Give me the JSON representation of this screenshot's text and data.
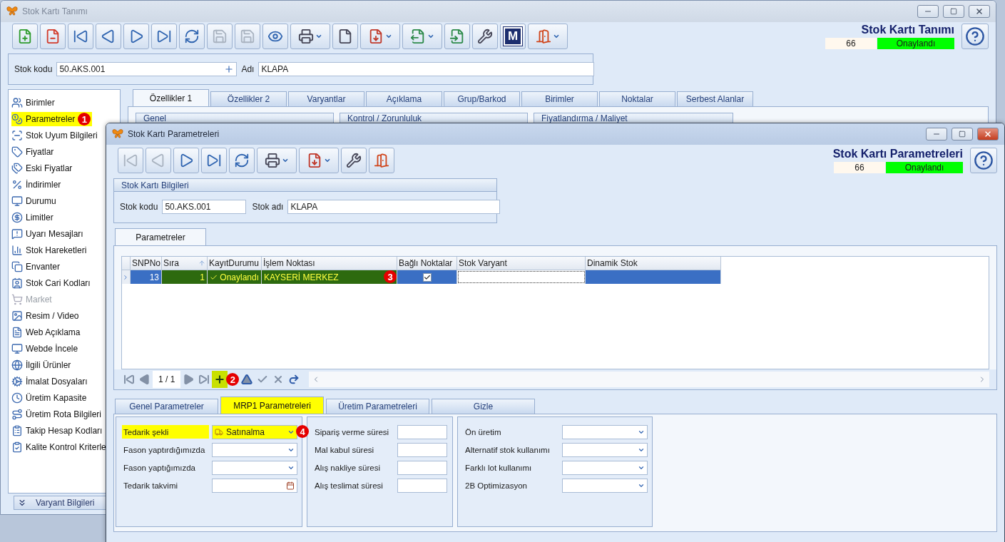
{
  "main_window": {
    "title": "Stok Kartı Tanımı",
    "header_title": "Stok Kartı Tanımı",
    "record_no": "66",
    "status": "Onaylandı",
    "toolbar": [
      {
        "kind": "new",
        "disabled": false,
        "dropdown": false
      },
      {
        "kind": "delete",
        "disabled": false,
        "dropdown": false
      },
      {
        "kind": "first",
        "disabled": false,
        "dropdown": false
      },
      {
        "kind": "previous",
        "disabled": false,
        "dropdown": false
      },
      {
        "kind": "next",
        "disabled": false,
        "dropdown": false
      },
      {
        "kind": "last",
        "disabled": false,
        "dropdown": false
      },
      {
        "kind": "refresh",
        "disabled": false,
        "dropdown": false
      },
      {
        "kind": "save",
        "disabled": true,
        "dropdown": false
      },
      {
        "kind": "save-cancel",
        "disabled": true,
        "dropdown": false
      },
      {
        "kind": "preview",
        "disabled": false,
        "dropdown": false
      },
      {
        "kind": "print",
        "disabled": false,
        "dropdown": true
      },
      {
        "kind": "attach",
        "disabled": false,
        "dropdown": false
      },
      {
        "kind": "pdf",
        "disabled": false,
        "dropdown": true
      },
      {
        "kind": "export",
        "disabled": false,
        "dropdown": true
      },
      {
        "kind": "import",
        "disabled": false,
        "dropdown": false
      },
      {
        "kind": "settings",
        "disabled": false,
        "dropdown": false
      },
      {
        "kind": "logo",
        "label": "M",
        "disabled": false,
        "dropdown": false
      },
      {
        "kind": "exit",
        "disabled": false,
        "dropdown": true
      }
    ],
    "fields": {
      "stok_kodu_label": "Stok kodu",
      "stok_kodu": "50.AKS.001",
      "adi_label": "Adı",
      "adi": "KLAPA"
    },
    "sidebar": {
      "items": [
        {
          "label": "Birimler",
          "selected": false,
          "disabled": false
        },
        {
          "label": "Parametreler",
          "selected": true,
          "disabled": false,
          "badge": "1"
        },
        {
          "label": "Stok Uyum Bilgileri",
          "selected": false,
          "disabled": false
        },
        {
          "label": "Fiyatlar",
          "selected": false,
          "disabled": false
        },
        {
          "label": "Eski Fiyatlar",
          "selected": false,
          "disabled": false
        },
        {
          "label": "İndirimler",
          "selected": false,
          "disabled": false
        },
        {
          "label": "Durumu",
          "selected": false,
          "disabled": false
        },
        {
          "label": "Limitler",
          "selected": false,
          "disabled": false
        },
        {
          "label": "Uyarı Mesajları",
          "selected": false,
          "disabled": false
        },
        {
          "label": "Stok Hareketleri",
          "selected": false,
          "disabled": false
        },
        {
          "label": "Envanter",
          "selected": false,
          "disabled": false
        },
        {
          "label": "Stok Cari Kodları",
          "selected": false,
          "disabled": false
        },
        {
          "label": "Market",
          "selected": false,
          "disabled": true
        },
        {
          "label": "Resim / Video",
          "selected": false,
          "disabled": false
        },
        {
          "label": "Web Açıklama",
          "selected": false,
          "disabled": false
        },
        {
          "label": "Webde İncele",
          "selected": false,
          "disabled": false
        },
        {
          "label": "İlgili Ürünler",
          "selected": false,
          "disabled": false
        },
        {
          "label": "İmalat Dosyaları",
          "selected": false,
          "disabled": false
        },
        {
          "label": "Üretim Kapasite",
          "selected": false,
          "disabled": false
        },
        {
          "label": "Üretim Rota Bilgileri",
          "selected": false,
          "disabled": false
        },
        {
          "label": "Takip Hesap Kodları",
          "selected": false,
          "disabled": false
        },
        {
          "label": "Kalite Kontrol Kriterle",
          "selected": false,
          "disabled": false
        }
      ],
      "footer_button": "Varyant Bilgileri"
    },
    "tabs": [
      {
        "label": "Özellikler 1",
        "selected": true
      },
      {
        "label": "Özellikler 2",
        "selected": false
      },
      {
        "label": "Varyantlar",
        "selected": false
      },
      {
        "label": "Açıklama",
        "selected": false
      },
      {
        "label": "Grup/Barkod",
        "selected": false
      },
      {
        "label": "Birimler",
        "selected": false
      },
      {
        "label": "Noktalar",
        "selected": false
      },
      {
        "label": "Serbest Alanlar",
        "selected": false
      }
    ],
    "groups": [
      "Genel",
      "Kontrol / Zorunluluk",
      "Fiyatlandırma / Maliyet"
    ]
  },
  "dialog": {
    "title": "Stok Kartı Parametreleri",
    "header_title": "Stok Kartı Parametreleri",
    "record_no": "66",
    "status": "Onaylandı",
    "toolbar": [
      {
        "kind": "first",
        "disabled": true,
        "dropdown": false
      },
      {
        "kind": "previous",
        "disabled": true,
        "dropdown": false
      },
      {
        "kind": "next",
        "disabled": false,
        "dropdown": false
      },
      {
        "kind": "last",
        "disabled": false,
        "dropdown": false
      },
      {
        "kind": "refresh",
        "disabled": false,
        "dropdown": false
      },
      {
        "kind": "print",
        "disabled": false,
        "dropdown": true
      },
      {
        "kind": "pdf",
        "disabled": false,
        "dropdown": true
      },
      {
        "kind": "settings",
        "disabled": false,
        "dropdown": false
      },
      {
        "kind": "exit",
        "disabled": false,
        "dropdown": false
      }
    ],
    "info": {
      "title": "Stok Kartı Bilgileri",
      "stok_kodu_label": "Stok kodu",
      "stok_kodu": "50.AKS.001",
      "stok_adi_label": "Stok adı",
      "stok_adi": "KLAPA"
    },
    "grid_tab": {
      "label": "Parametreler",
      "selected": true
    },
    "grid": {
      "columns": [
        "SNPNo",
        "Sıra",
        "KayıtDurumu",
        "İşlem Noktası",
        "Bağlı Noktalar",
        "Stok Varyant",
        "Dinamik Stok"
      ],
      "rows": [
        {
          "snpno": "13",
          "sira": "1",
          "status": "Onaylandı",
          "approved": true,
          "islem_noktasi": "KAYSERİ MERKEZ",
          "bagli_noktalar": true,
          "selected": true,
          "highlighted": true,
          "badge": "3"
        }
      ]
    },
    "navigator": [
      {
        "kind": "first"
      },
      {
        "kind": "previous"
      },
      {
        "kind": "page",
        "label": "1 / 1"
      },
      {
        "kind": "next"
      },
      {
        "kind": "last"
      },
      {
        "kind": "add",
        "highlighted": true,
        "badge": "2"
      },
      {
        "kind": "up"
      },
      {
        "kind": "check"
      },
      {
        "kind": "cancel"
      },
      {
        "kind": "redo"
      }
    ],
    "tabs": [
      {
        "label": "Genel Parametreler",
        "selected": false
      },
      {
        "label": "MRP1 Parametreleri",
        "selected": true
      },
      {
        "label": "Üretim Parametreleri",
        "selected": false
      },
      {
        "label": "Gizle",
        "selected": false
      }
    ],
    "panels": [
      [
        {
          "label": "Tedarik şekli",
          "kind": "dropdown",
          "value": "Satınalma",
          "highlighted": true,
          "badge": "4"
        },
        {
          "label": "Fason yaptırdığımızda",
          "kind": "dropdown",
          "highlighted": false
        },
        {
          "label": "Fason yaptığımızda",
          "kind": "dropdown",
          "highlighted": false
        },
        {
          "label": "Tedarik takvimi",
          "kind": "date",
          "highlighted": false
        }
      ],
      [
        {
          "label": "Sipariş verme süresi",
          "kind": "text",
          "highlighted": false
        },
        {
          "label": "Mal kabul süresi",
          "kind": "text",
          "highlighted": false
        },
        {
          "label": "Alış nakliye süresi",
          "kind": "text",
          "highlighted": false
        },
        {
          "label": "Alış teslimat süresi",
          "kind": "text",
          "highlighted": false
        }
      ],
      [
        {
          "label": "Ön üretim",
          "kind": "dropdown",
          "highlighted": false
        },
        {
          "label": "Alternatif stok kullanımı",
          "kind": "dropdown",
          "highlighted": false
        },
        {
          "label": "Farklı lot kullanımı",
          "kind": "dropdown",
          "highlighted": false
        },
        {
          "label": "2B Optimizasyon",
          "kind": "dropdown",
          "highlighted": false
        }
      ]
    ]
  }
}
